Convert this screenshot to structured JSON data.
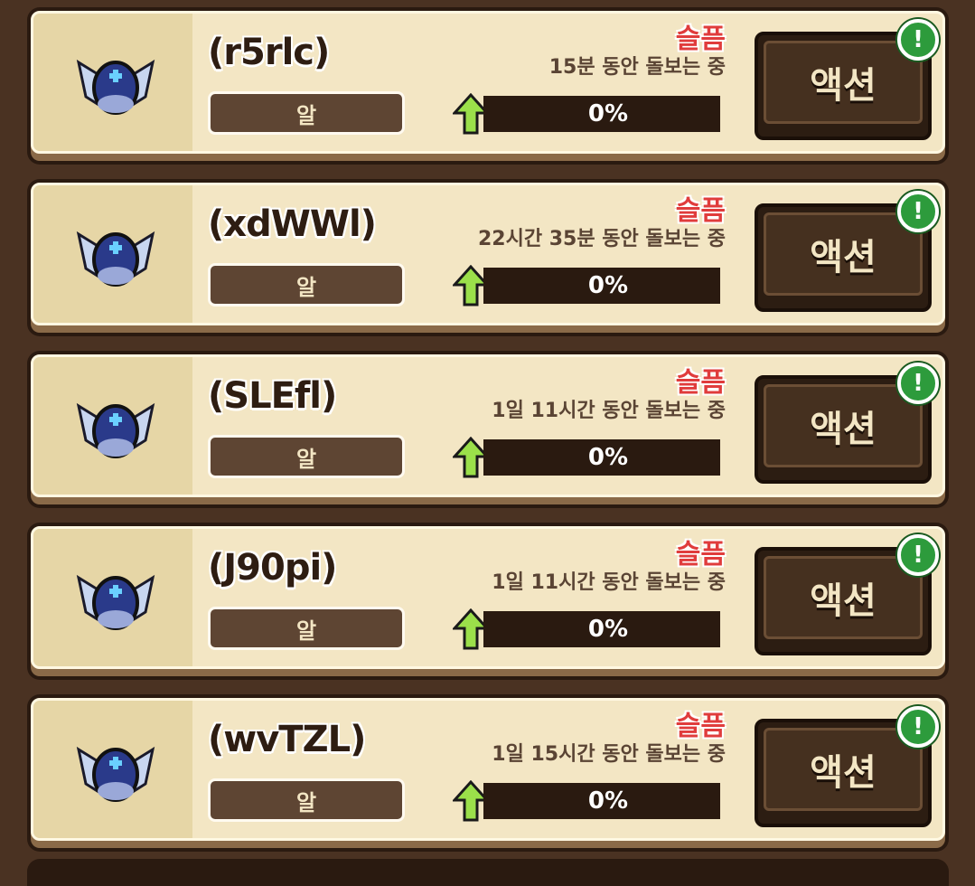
{
  "colors": {
    "background": "#4a3222",
    "card": "#f3e6c4",
    "status_red": "#e03c3c",
    "badge_green": "#2d9b3c",
    "arrow_green": "#7ad33a"
  },
  "pets": [
    {
      "name": "(r5rlc)",
      "type": "알",
      "status": "슬픔",
      "care_time": "15분 동안 돌보는 중",
      "progress": "0%",
      "progress_value": 0,
      "action_label": "액션",
      "alert": "!"
    },
    {
      "name": "(xdWWl)",
      "type": "알",
      "status": "슬픔",
      "care_time": "22시간 35분 동안 돌보는 중",
      "progress": "0%",
      "progress_value": 0,
      "action_label": "액션",
      "alert": "!"
    },
    {
      "name": "(SLEfl)",
      "type": "알",
      "status": "슬픔",
      "care_time": "1일 11시간 동안 돌보는 중",
      "progress": "0%",
      "progress_value": 0,
      "action_label": "액션",
      "alert": "!"
    },
    {
      "name": "(J90pi)",
      "type": "알",
      "status": "슬픔",
      "care_time": "1일 11시간 동안 돌보는 중",
      "progress": "0%",
      "progress_value": 0,
      "action_label": "액션",
      "alert": "!"
    },
    {
      "name": "(wvTZL)",
      "type": "알",
      "status": "슬픔",
      "care_time": "1일 15시간 동안 돌보는 중",
      "progress": "0%",
      "progress_value": 0,
      "action_label": "액션",
      "alert": "!"
    }
  ],
  "icons": {
    "egg": "winged-egg-icon",
    "progress": "up-arrow-icon",
    "alert": "exclamation-icon"
  }
}
